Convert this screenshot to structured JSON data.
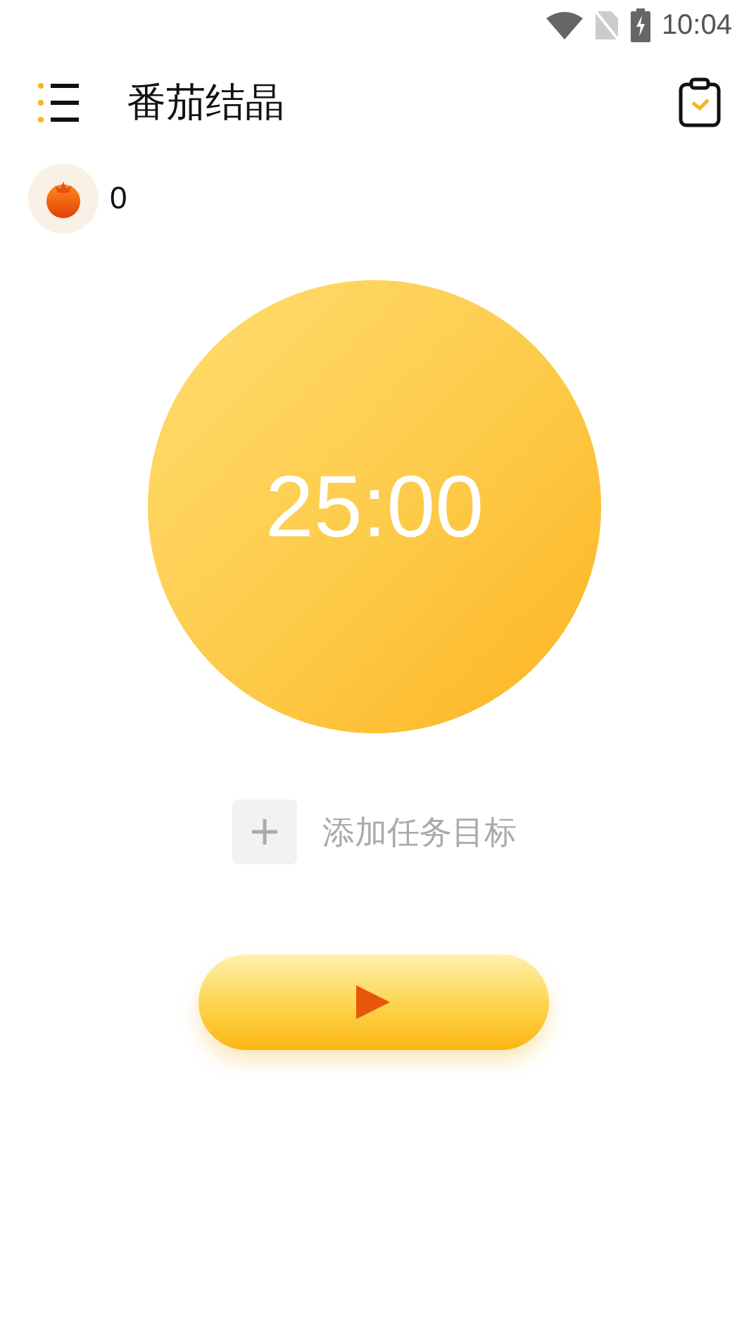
{
  "status_bar": {
    "time": "10:04"
  },
  "header": {
    "title": "番茄结晶"
  },
  "tomato_count": "0",
  "timer": {
    "time": "25:00"
  },
  "task": {
    "label": "添加任务目标"
  }
}
